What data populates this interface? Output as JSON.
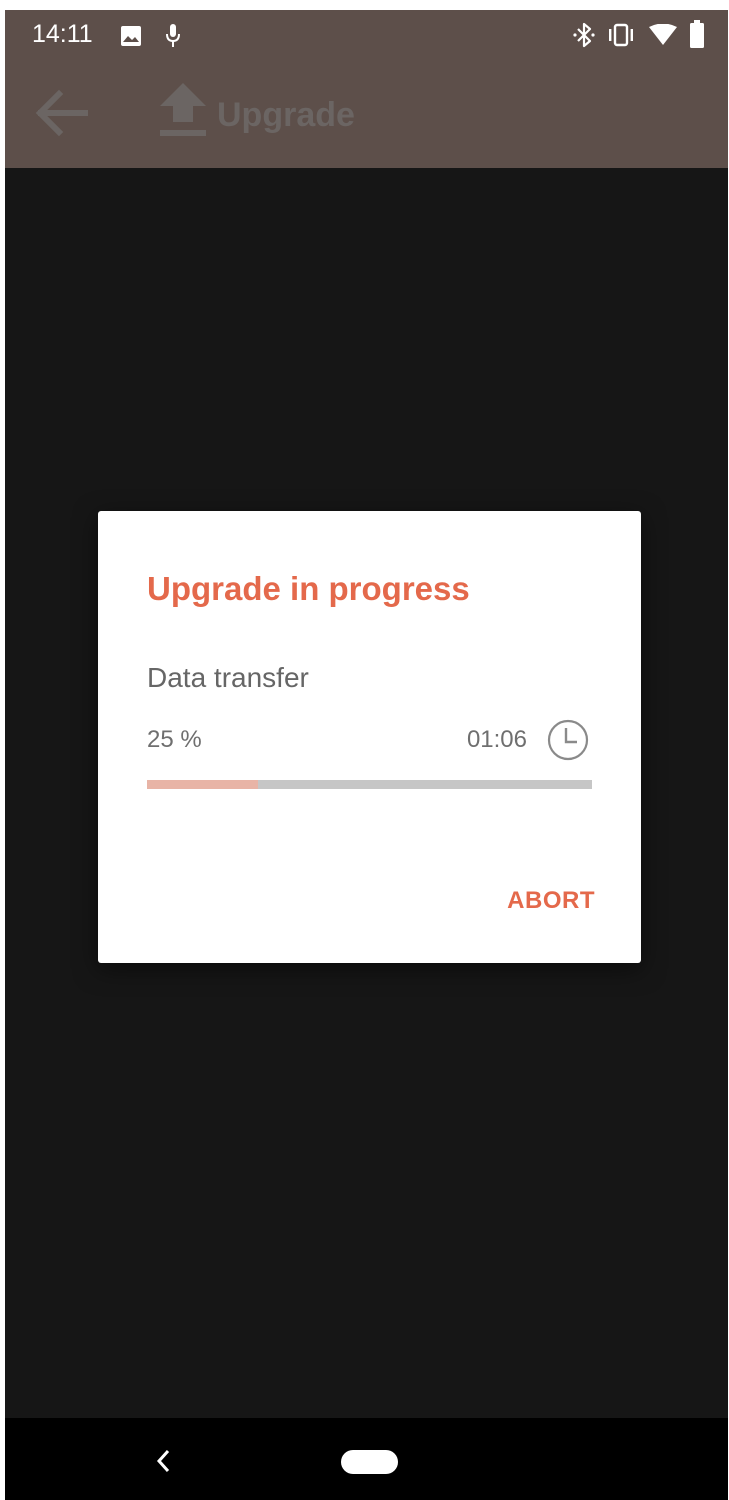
{
  "status_bar": {
    "time": "14:11",
    "icons": [
      "image-icon",
      "mic-icon",
      "bluetooth-icon",
      "vibrate-icon",
      "wifi-icon",
      "battery-icon"
    ]
  },
  "app_bar": {
    "title": "Upgrade",
    "back_icon": "arrow-back-icon",
    "title_icon": "upload-icon"
  },
  "dialog": {
    "title": "Upgrade in progress",
    "subtitle": "Data transfer",
    "percent_label": "25 %",
    "time_remaining": "01:06",
    "progress": 0.25,
    "abort_label": "ABORT"
  },
  "colors": {
    "accent": "#e4694b",
    "progress_fill": "#e8b4a6",
    "progress_track": "#c6c6c6",
    "app_bar": "#5d4f4a"
  },
  "nav_bar": {
    "icons": [
      "nav-back-icon",
      "home-pill-icon"
    ]
  }
}
